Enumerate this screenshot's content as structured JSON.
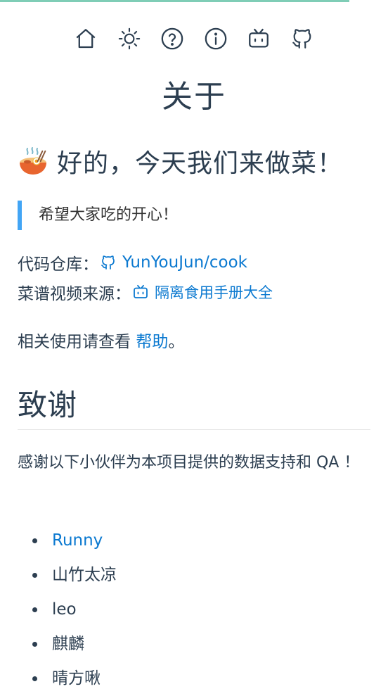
{
  "nav": {
    "icons": [
      "home-icon",
      "sun-icon",
      "help-circle-icon",
      "info-icon",
      "bilibili-icon",
      "github-icon"
    ]
  },
  "page": {
    "title": "关于"
  },
  "headline": {
    "text": "好的，今天我们来做菜！"
  },
  "quote": {
    "text": "希望大家吃的开心！"
  },
  "repo": {
    "label": "代码仓库：",
    "link_text": "YunYouJun/cook"
  },
  "source": {
    "label": "菜谱视频来源：",
    "link_text": "隔离食用手册大全"
  },
  "help": {
    "prefix": "相关使用请查看 ",
    "link_text": "帮助",
    "suffix": "。"
  },
  "thanks_section": {
    "title": "致谢",
    "text": "感谢以下小伙伴为本项目提供的数据支持和 QA ！"
  },
  "contributors": [
    {
      "name": "Runny",
      "is_link": true
    },
    {
      "name": "山竹太凉",
      "is_link": false
    },
    {
      "name": "leo",
      "is_link": false
    },
    {
      "name": "麒麟",
      "is_link": false
    },
    {
      "name": "晴方啾",
      "is_link": false
    }
  ],
  "colors": {
    "accent": "#0b79d0",
    "quote_border": "#42a5f5",
    "progress": "#7fcdb6",
    "text": "#2c3e50"
  }
}
